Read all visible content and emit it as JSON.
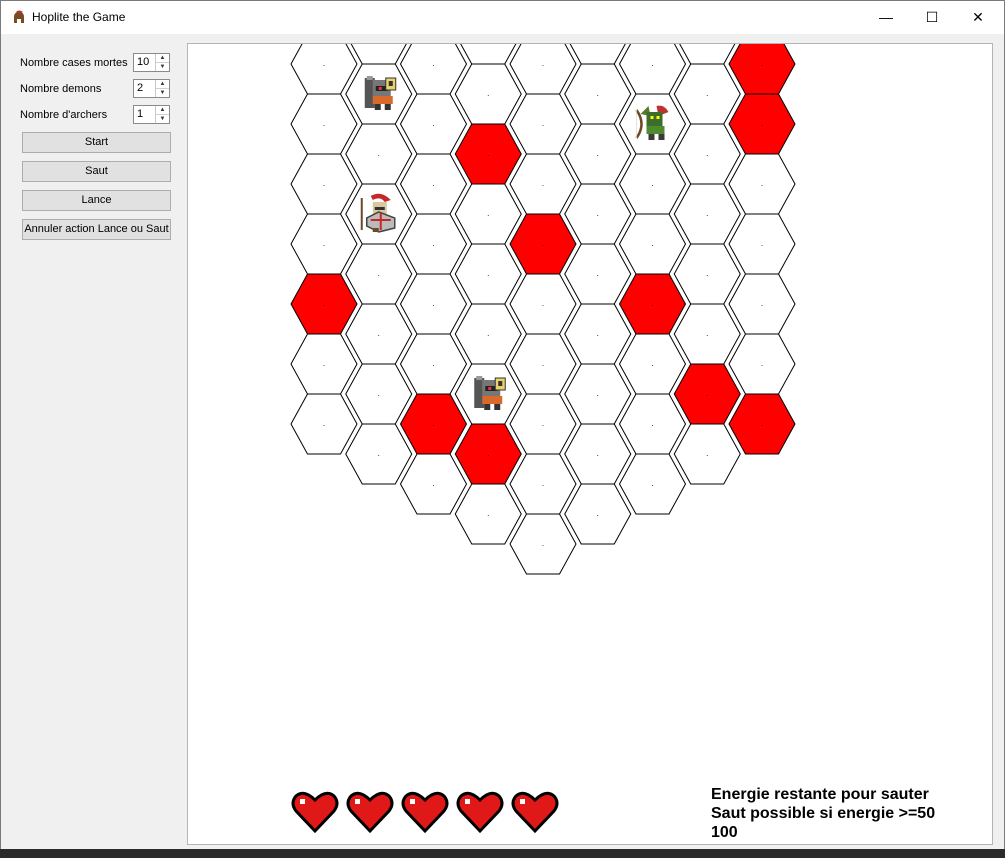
{
  "window": {
    "title": "Hoplite the Game",
    "icon": "spartan-helmet-icon",
    "controls": {
      "minimize": "—",
      "maximize": "☐",
      "close": "✕"
    }
  },
  "settings": {
    "dead_tiles": {
      "label": "Nombre cases mortes",
      "value": "10"
    },
    "demons": {
      "label": "Nombre demons",
      "value": "2"
    },
    "archers": {
      "label": "Nombre d'archers",
      "value": "1"
    }
  },
  "buttons": {
    "start": "Start",
    "jump": "Saut",
    "spear": "Lance",
    "cancel": "Annuler action Lance ou Saut"
  },
  "board": {
    "columns": [
      {
        "col": 0,
        "rows": 7
      },
      {
        "col": 1,
        "rows": 8
      },
      {
        "col": 2,
        "rows": 9
      },
      {
        "col": 3,
        "rows": 10
      },
      {
        "col": 4,
        "rows": 11
      },
      {
        "col": 5,
        "rows": 10
      },
      {
        "col": 6,
        "rows": 9
      },
      {
        "col": 7,
        "rows": 8
      },
      {
        "col": 8,
        "rows": 7
      }
    ],
    "tile_marker": ".",
    "dead_tiles": [
      [
        0,
        4
      ],
      [
        2,
        7
      ],
      [
        3,
        3
      ],
      [
        3,
        8
      ],
      [
        4,
        5
      ],
      [
        6,
        5
      ],
      [
        7,
        6
      ],
      [
        8,
        0
      ],
      [
        8,
        1
      ],
      [
        8,
        6
      ]
    ],
    "units": [
      {
        "type": "demon",
        "icon": "demon-icon",
        "col": 1,
        "row": 1
      },
      {
        "type": "hoplite",
        "icon": "hoplite-player-icon",
        "col": 1,
        "row": 3
      },
      {
        "type": "demon",
        "icon": "demon-icon",
        "col": 3,
        "row": 7
      },
      {
        "type": "archer",
        "icon": "archer-goblin-icon",
        "col": 6,
        "row": 2
      }
    ],
    "colors": {
      "dead": "#ff0000",
      "tile": "#ffffff",
      "border": "#000000"
    }
  },
  "status": {
    "hearts": 5,
    "heart_icon": "heart-icon",
    "energy_line1": "Energie restante pour sauter",
    "energy_line2": "Saut possible si energie >=50",
    "energy_value": "100"
  }
}
